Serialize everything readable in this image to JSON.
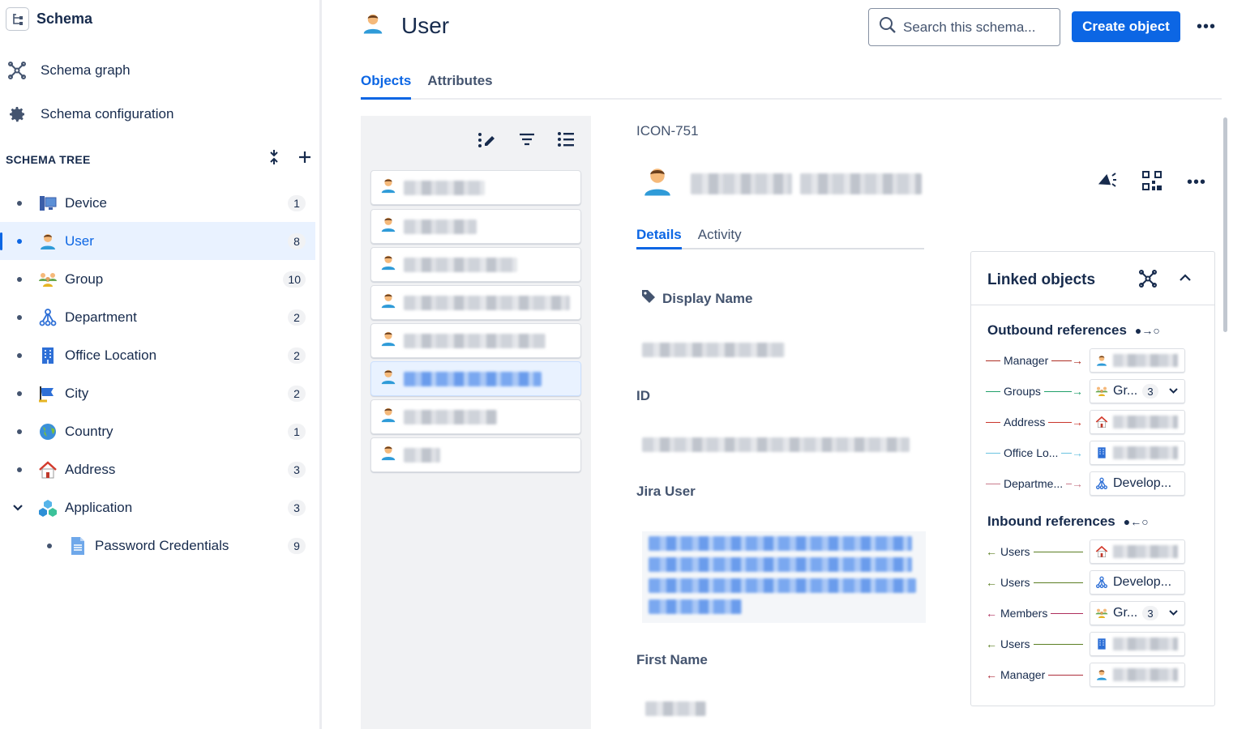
{
  "sidebar": {
    "title": "Schema",
    "links": [
      {
        "label": "Schema graph",
        "icon": "graph-icon"
      },
      {
        "label": "Schema configuration",
        "icon": "gear-icon"
      }
    ],
    "tree_title": "SCHEMA TREE",
    "items": [
      {
        "label": "Device",
        "count": "1",
        "icon": "device-icon"
      },
      {
        "label": "User",
        "count": "8",
        "icon": "user-icon",
        "selected": true
      },
      {
        "label": "Group",
        "count": "10",
        "icon": "group-icon"
      },
      {
        "label": "Department",
        "count": "2",
        "icon": "department-icon"
      },
      {
        "label": "Office Location",
        "count": "2",
        "icon": "office-icon"
      },
      {
        "label": "City",
        "count": "2",
        "icon": "city-flag-icon"
      },
      {
        "label": "Country",
        "count": "1",
        "icon": "globe-icon"
      },
      {
        "label": "Address",
        "count": "3",
        "icon": "house-icon"
      },
      {
        "label": "Application",
        "count": "3",
        "icon": "application-icon",
        "expanded": true
      },
      {
        "label": "Password Credentials",
        "count": "9",
        "icon": "document-icon",
        "child": true
      }
    ]
  },
  "header": {
    "title": "User",
    "search_placeholder": "Search this schema...",
    "create_label": "Create object",
    "more": "•••"
  },
  "tabs": [
    "Objects",
    "Attributes"
  ],
  "detail": {
    "key": "ICON-751",
    "tabs": [
      "Details",
      "Activity"
    ],
    "attributes": [
      {
        "label": "Display Name"
      },
      {
        "label": "ID"
      },
      {
        "label": "Jira User"
      },
      {
        "label": "First Name"
      }
    ],
    "more": "•••"
  },
  "linked": {
    "title": "Linked objects",
    "outbound_title": "Outbound references",
    "outbound_symbol": "●→○",
    "inbound_title": "Inbound references",
    "inbound_symbol": "●←○",
    "outbound": [
      {
        "label": "Manager",
        "color": "#ae2e24",
        "chip_icon": "user-icon",
        "chip_text": ""
      },
      {
        "label": "Groups",
        "color": "#22a06b",
        "chip_icon": "group-icon",
        "chip_text": "Gr...",
        "count": "3"
      },
      {
        "label": "Address",
        "color": "#c9372c",
        "chip_icon": "house-icon",
        "chip_text": ""
      },
      {
        "label": "Office Lo...",
        "color": "#6cc3e0",
        "chip_icon": "office-icon",
        "chip_text": ""
      },
      {
        "label": "Departme...",
        "color": "#c97c8c",
        "chip_icon": "department-icon",
        "chip_text": "Develop..."
      }
    ],
    "inbound": [
      {
        "label": "Users",
        "color": "#5b7f24",
        "chip_icon": "house-icon",
        "chip_text": ""
      },
      {
        "label": "Users",
        "color": "#5b7f24",
        "chip_icon": "department-icon",
        "chip_text": "Develop..."
      },
      {
        "label": "Members",
        "color": "#ae2e5c",
        "chip_icon": "group-icon",
        "chip_text": "Gr...",
        "count": "3"
      },
      {
        "label": "Users",
        "color": "#5b7f24",
        "chip_icon": "office-icon",
        "chip_text": ""
      },
      {
        "label": "Manager",
        "color": "#ae2e3c",
        "chip_icon": "user-icon",
        "chip_text": ""
      }
    ]
  },
  "colors": {
    "accent": "#0c66e4",
    "selected_bg": "#e9f2ff"
  }
}
